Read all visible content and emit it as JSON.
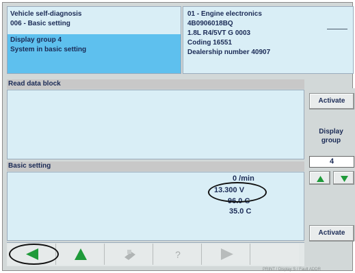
{
  "header": {
    "left_lines": [
      "Vehicle self-diagnosis",
      "006 - Basic setting",
      "Display group 4",
      "System in basic setting"
    ],
    "right_lines": [
      "01 - Engine electronics",
      "4B0906018BQ",
      "1.8L R4/5VT    G   0003",
      "Coding 16551",
      "Dealership number 40907"
    ]
  },
  "read_data_block": {
    "title": "Read data block"
  },
  "basic_setting": {
    "title": "Basic setting",
    "values": [
      "0 /min",
      "13.300  V",
      "96.0  C",
      "35.0  C"
    ]
  },
  "right_panel": {
    "activate_top": "Activate",
    "display_group_label": "Display group",
    "display_group_value": "4",
    "activate_bottom": "Activate"
  },
  "colors": {
    "selection": "#5ec0ee",
    "panel": "#d9eef6",
    "arrow_green": "#1f9a3a"
  },
  "nav": {
    "buttons": [
      {
        "icon": "back-arrow-icon",
        "enabled": true
      },
      {
        "icon": "up-arrow-icon",
        "enabled": true
      },
      {
        "icon": "print-icon",
        "enabled": false
      },
      {
        "icon": "help-icon",
        "enabled": false
      },
      {
        "icon": "forward-arrow-icon",
        "enabled": false
      }
    ],
    "help_glyph": "?"
  },
  "footer": {
    "text": "PRINT  /  Display  S  /  Fault  ADDR"
  }
}
